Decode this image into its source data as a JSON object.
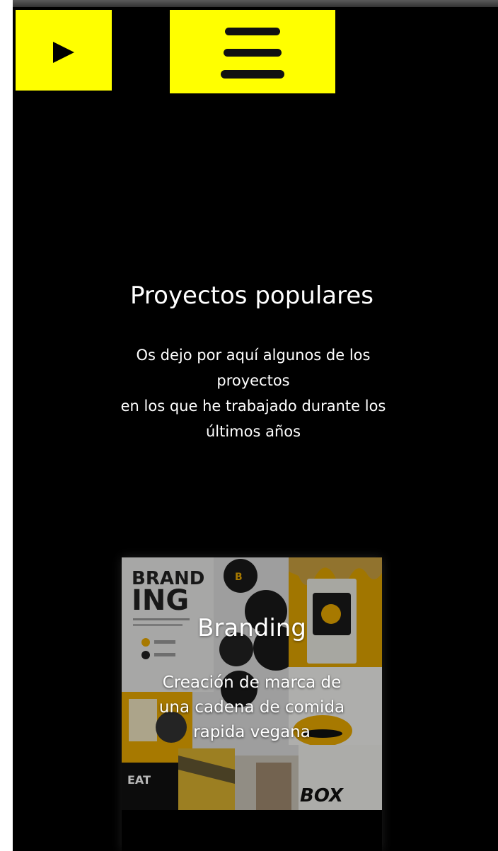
{
  "header": {
    "play_button": {
      "icon": "play-icon",
      "color": "#ffff00"
    },
    "menu_button": {
      "icon": "hamburger-menu-icon",
      "color": "#ffff00"
    }
  },
  "section": {
    "title": "Proyectos populares",
    "intro_lines": [
      "Os dejo por aquí algunos de los",
      "proyectos",
      "en los que he trabajado durante los",
      "últimos años"
    ]
  },
  "projects": [
    {
      "title": "Branding",
      "description": "Creación de marca de una cadena de comida rapida vegana",
      "image_text": {
        "brand_line1": "BRAND",
        "brand_line2": "ING",
        "box": "BOX"
      }
    }
  ],
  "colors": {
    "accent": "#ffff00",
    "background": "#000000",
    "text": "#ffffff"
  }
}
